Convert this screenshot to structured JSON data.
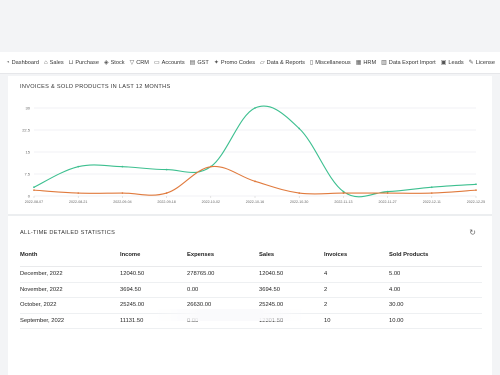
{
  "nav": {
    "items": [
      {
        "label": "Dashboard",
        "icon": "dashboard-icon",
        "glyph": "◔"
      },
      {
        "label": "Sales",
        "icon": "tag-icon",
        "glyph": "⌂"
      },
      {
        "label": "Purchase",
        "icon": "cart-icon",
        "glyph": "⊔"
      },
      {
        "label": "Stock",
        "icon": "box-icon",
        "glyph": "◈"
      },
      {
        "label": "CRM",
        "icon": "filter-icon",
        "glyph": "▽"
      },
      {
        "label": "Accounts",
        "icon": "wallet-icon",
        "glyph": "▭"
      },
      {
        "label": "GST",
        "icon": "receipt-icon",
        "glyph": "▤"
      },
      {
        "label": "Promo Codes",
        "icon": "gift-icon",
        "glyph": "✦"
      },
      {
        "label": "Data & Reports",
        "icon": "folder-icon",
        "glyph": "▱"
      },
      {
        "label": "Miscellaneous",
        "icon": "document-icon",
        "glyph": "▯"
      },
      {
        "label": "HRM",
        "icon": "calendar-icon",
        "glyph": "▦"
      },
      {
        "label": "Data Export Import",
        "icon": "bar-chart-icon",
        "glyph": "▥"
      },
      {
        "label": "Leads",
        "icon": "clipboard-icon",
        "glyph": "▣"
      },
      {
        "label": "License",
        "icon": "edit-icon",
        "glyph": "✎"
      }
    ]
  },
  "chart_section": {
    "title": "INVOICES & SOLD PRODUCTS IN LAST 12 MONTHS"
  },
  "chart_data": {
    "type": "line",
    "title": "INVOICES & SOLD PRODUCTS IN LAST 12 MONTHS",
    "xlabel": "",
    "ylabel": "",
    "x": [
      "2022-08-07",
      "2022-08-21",
      "2022-09-04",
      "2022-09-18",
      "2022-10-02",
      "2022-10-16",
      "2022-10-30",
      "2022-11-13",
      "2022-11-27",
      "2022-12-11",
      "2022-12-25"
    ],
    "yticks": [
      "0",
      "7.5",
      "15",
      "22.5",
      "30"
    ],
    "ylim": [
      0,
      30
    ],
    "grid": true,
    "series": [
      {
        "color": "#3cbf8f",
        "values": [
          3,
          10,
          10,
          9,
          10,
          30,
          23,
          1.5,
          1.5,
          3,
          4
        ]
      },
      {
        "color": "#e07a3d",
        "values": [
          2,
          1,
          1,
          1,
          10,
          5,
          1,
          1,
          1,
          1,
          2
        ]
      }
    ]
  },
  "stats": {
    "title": "ALL-TIME DETAILED STATISTICS",
    "refresh_icon": "refresh-icon",
    "refresh_glyph": "↻",
    "headers": {
      "month": "Month",
      "income": "Income",
      "expenses": "Expenses",
      "sales": "Sales",
      "invoices": "Invoices",
      "sold_products": "Sold Products"
    },
    "rows": [
      {
        "month": "December, 2022",
        "income": "12040.50",
        "expenses": "278765.00",
        "sales": "12040.50",
        "invoices": "4",
        "sold_products": "5.00"
      },
      {
        "month": "November, 2022",
        "income": "3694.50",
        "expenses": "0.00",
        "sales": "3694.50",
        "invoices": "2",
        "sold_products": "4.00"
      },
      {
        "month": "October, 2022",
        "income": "25245.00",
        "expenses": "26630.00",
        "sales": "25245.00",
        "invoices": "2",
        "sold_products": "30.00"
      },
      {
        "month": "September, 2022",
        "income": "11131.50",
        "expenses": "0.00",
        "sales": "12301.50",
        "invoices": "10",
        "sold_products": "10.00"
      }
    ]
  }
}
